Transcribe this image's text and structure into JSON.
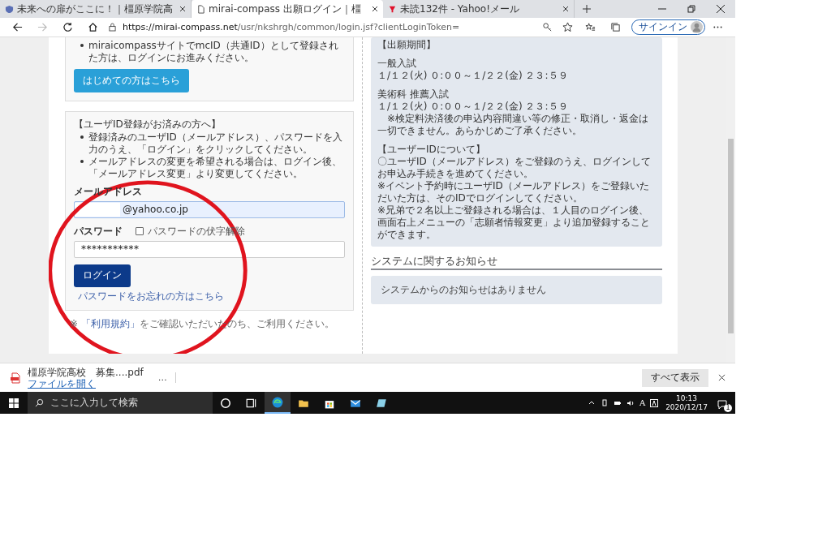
{
  "browser": {
    "tabs": [
      {
        "title": "未来への扉がここに！｜橿原学院高",
        "selected": false
      },
      {
        "title": "mirai-compass 出願ログイン｜橿",
        "selected": true
      },
      {
        "title": "未読132件 - Yahoo!メール",
        "selected": false
      }
    ],
    "url_host": "https://mirai-compass.net",
    "url_path": "/usr/nkshrgh/common/login.jsf?clientLoginToken=",
    "signin": "サインイン"
  },
  "first_box": {
    "bullets": [
      "miraicompassサイトでmcID（共通ID）として登録された方は、ログインにお進みください。"
    ],
    "button": "はじめての方はこちら"
  },
  "login_box": {
    "heading": "【ユーザID登録がお済みの方へ】",
    "bullets": [
      "登録済みのユーザID（メールアドレス）、パスワードを入力のうえ、「ログイン」をクリックしてください。",
      "メールアドレスの変更を希望される場合は、ログイン後、「メールアドレス変更」より変更してください。"
    ],
    "email_label": "メールアドレス",
    "email_value": "@yahoo.co.jp",
    "password_label": "パスワード",
    "show_password": {
      "label": "パスワードの伏字解除",
      "checked": false
    },
    "password_value": "***********",
    "login_button": "ログイン",
    "forgot_link": "パスワードをお忘れの方はこちら"
  },
  "terms_note": {
    "prefix": "※ ",
    "link": "「利用規約」",
    "suffix": "をご確認いただいたのち、ご利用ください。"
  },
  "info_panel": {
    "blocks": [
      [
        "【出願期間】"
      ],
      [
        "一般入試",
        "１/１２(火) ０:００～１/２２(金) ２３:５９"
      ],
      [
        "美術科 推薦入試",
        "１/１２(火) ０:００～１/２２(金) ２３:５９",
        "　※検定料決済後の申込内容間違い等の修正・取消し・返金は一切できません。あらかじめご了承ください。"
      ],
      [
        "【ユーザーIDについて】",
        "〇ユーザID（メールアドレス）をご登録のうえ、ログインしてお申込み手続きを進めてください。",
        "※イベント予約時にユーザID（メールアドレス）をご登録いただいた方は、そのIDでログインしてください。",
        "※兄弟で２名以上ご登録される場合は、１人目のログイン後、画面右上メニューの「志願者情報変更」より追加登録することができます。"
      ]
    ]
  },
  "system_notice": {
    "heading": "システムに関するお知らせ",
    "message": "システムからのお知らせはありません"
  },
  "downloads": {
    "file": "橿原学院高校　募集....pdf",
    "action": "ファイルを開く",
    "more": "…",
    "show_all": "すべて表示"
  },
  "taskbar": {
    "search_placeholder": "ここに入力して検索",
    "ime": "A",
    "time": "10:13",
    "date": "2020/12/17",
    "notifications": "1"
  }
}
